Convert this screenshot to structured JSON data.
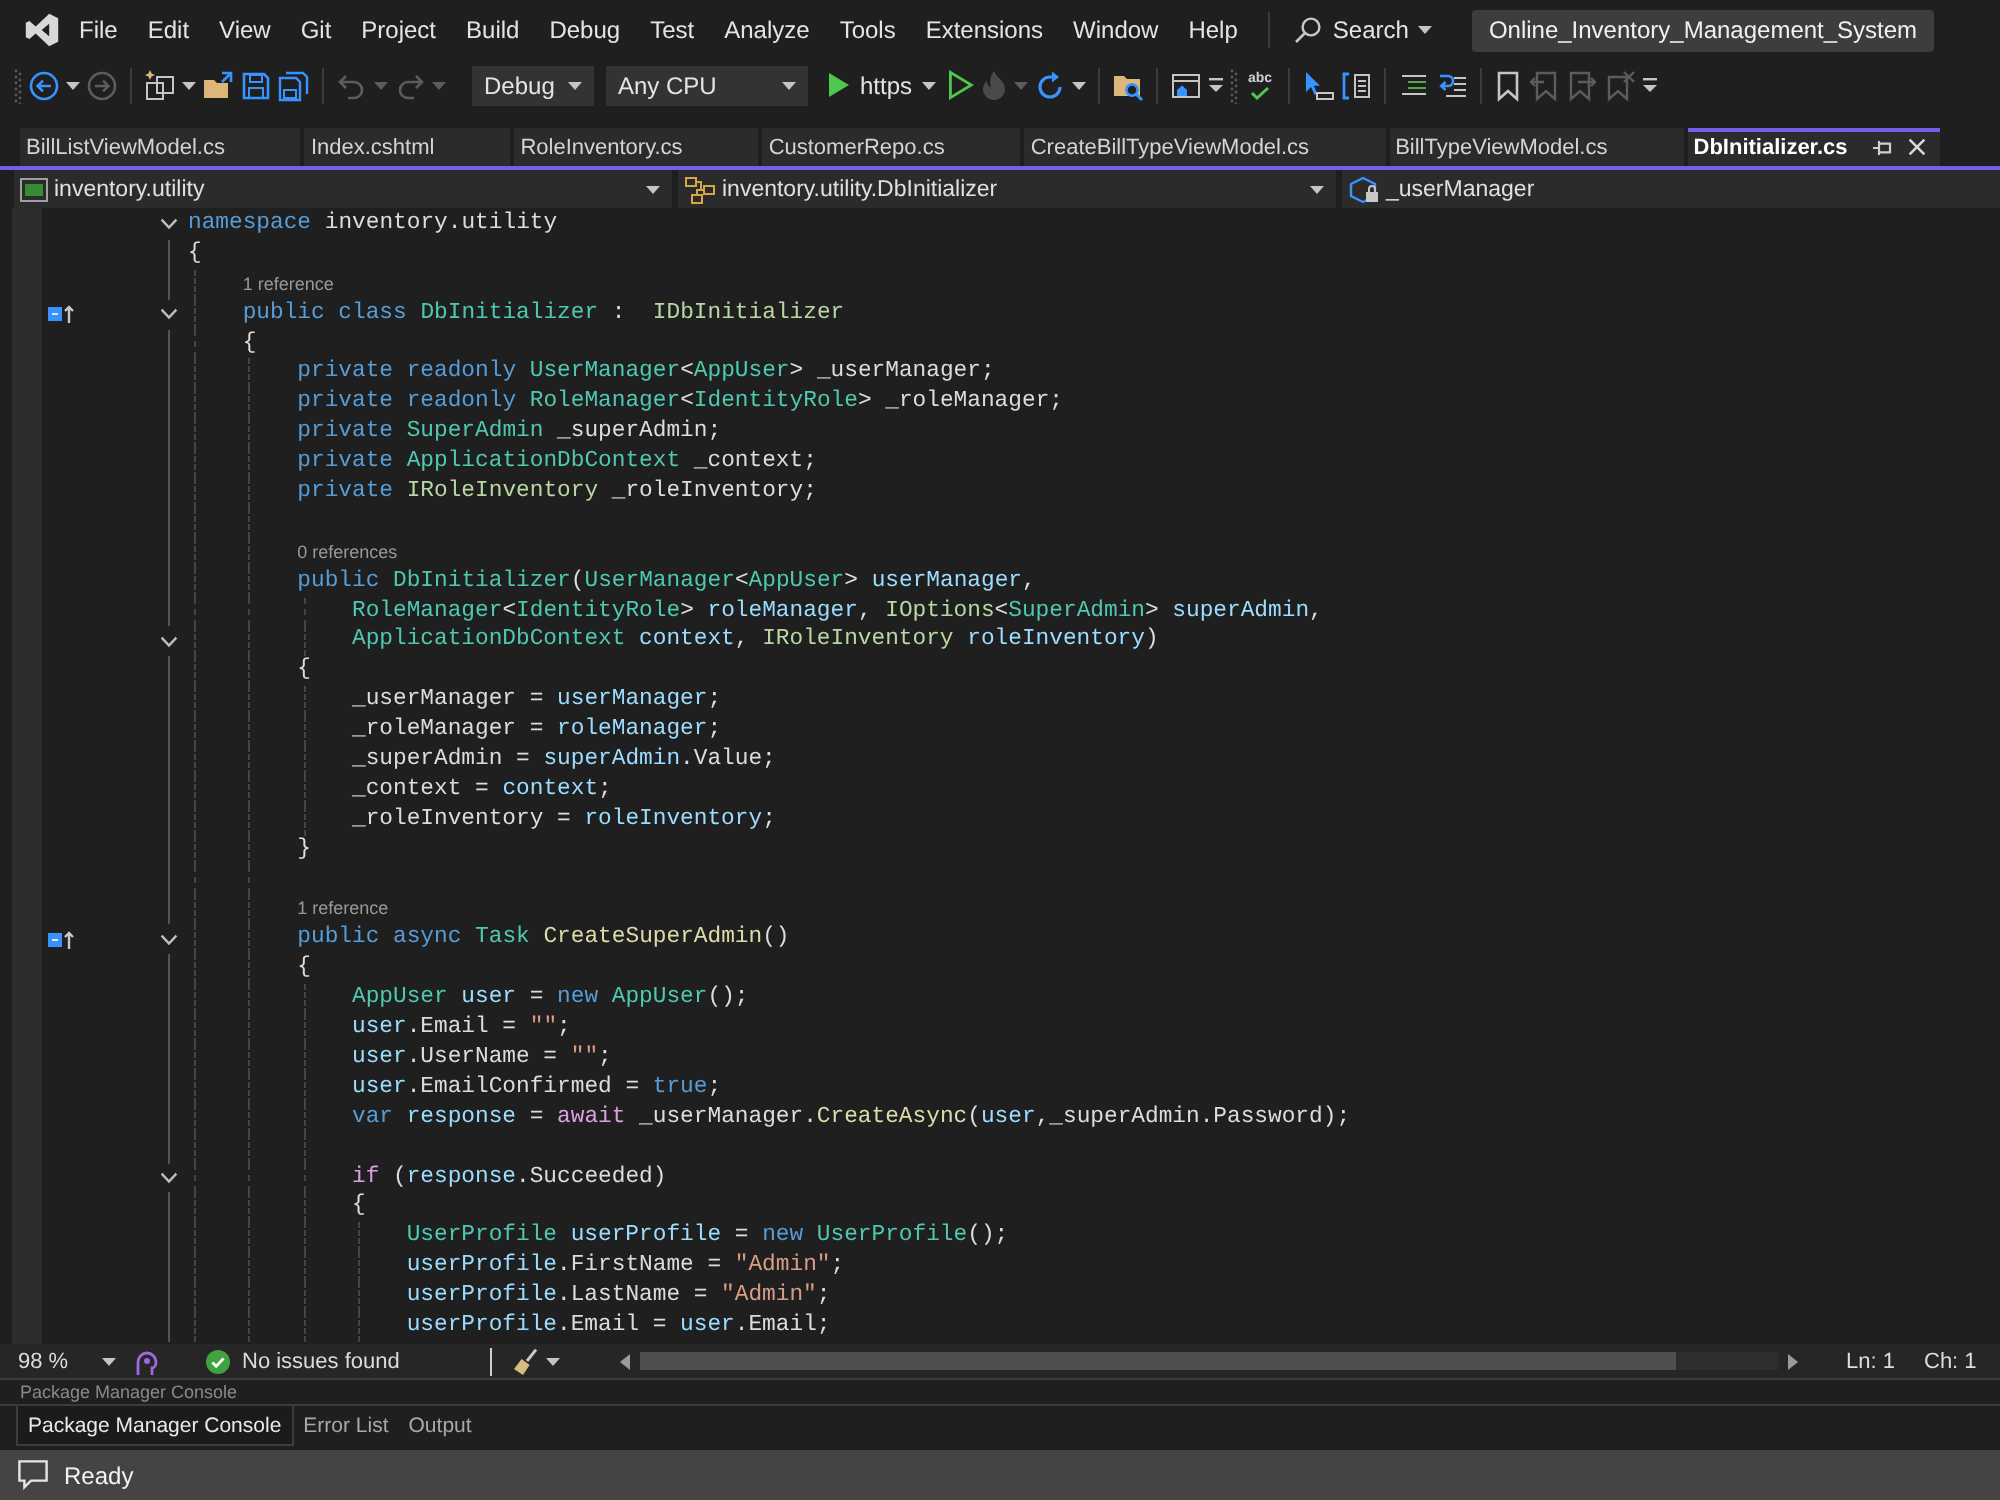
{
  "menu_bar": {
    "items": [
      "File",
      "Edit",
      "View",
      "Git",
      "Project",
      "Build",
      "Debug",
      "Test",
      "Analyze",
      "Tools",
      "Extensions",
      "Window",
      "Help"
    ],
    "search": "Search",
    "solution_name": "Online_Inventory_Management_System"
  },
  "toolbar": {
    "items": [
      {
        "kind": "grip"
      },
      {
        "kind": "back",
        "disabled": false
      },
      {
        "kind": "caret",
        "disabled": false
      },
      {
        "kind": "forward",
        "disabled": true
      },
      {
        "kind": "separator"
      },
      {
        "kind": "new-item",
        "disabled": false
      },
      {
        "kind": "caret",
        "disabled": false
      },
      {
        "kind": "open-folder",
        "disabled": false
      },
      {
        "kind": "save",
        "disabled": false
      },
      {
        "kind": "save-all",
        "disabled": false
      },
      {
        "kind": "separator"
      },
      {
        "kind": "undo",
        "disabled": true
      },
      {
        "kind": "caret",
        "disabled": true
      },
      {
        "kind": "redo",
        "disabled": true
      },
      {
        "kind": "caret",
        "disabled": true
      },
      {
        "kind": "configuration",
        "label": "Debug"
      },
      {
        "kind": "platform",
        "label": "Any CPU"
      },
      {
        "kind": "run",
        "label": "https"
      },
      {
        "kind": "run-outline",
        "disabled": false
      },
      {
        "kind": "flame",
        "disabled": true
      },
      {
        "kind": "caret",
        "disabled": true
      },
      {
        "kind": "restart",
        "disabled": false
      },
      {
        "kind": "caret",
        "disabled": false
      },
      {
        "kind": "separator"
      },
      {
        "kind": "folder-search",
        "disabled": false
      },
      {
        "kind": "separator"
      },
      {
        "kind": "window",
        "disabled": false
      },
      {
        "kind": "overflow"
      },
      {
        "kind": "grip"
      },
      {
        "kind": "spell-check",
        "label": "abc"
      },
      {
        "kind": "separator"
      },
      {
        "kind": "cursor",
        "disabled": false
      },
      {
        "kind": "bracket-doc",
        "disabled": false
      },
      {
        "kind": "separator"
      },
      {
        "kind": "comment",
        "disabled": false
      },
      {
        "kind": "uncomment",
        "disabled": false
      },
      {
        "kind": "separator"
      },
      {
        "kind": "bookmark",
        "disabled": false
      },
      {
        "kind": "bookmark-prev",
        "disabled": true
      },
      {
        "kind": "bookmark-next",
        "disabled": true
      },
      {
        "kind": "bookmark-clear",
        "disabled": true
      },
      {
        "kind": "overflow"
      }
    ]
  },
  "document_tabs": [
    {
      "label": "BillListViewModel.cs",
      "selected": false
    },
    {
      "label": "Index.cshtml",
      "selected": false
    },
    {
      "label": "RoleInventory.cs",
      "selected": false
    },
    {
      "label": "CustomerRepo.cs",
      "selected": false
    },
    {
      "label": "CreateBillTypeViewModel.cs",
      "selected": false
    },
    {
      "label": "BillTypeViewModel.cs",
      "selected": false
    },
    {
      "label": "DbInitializer.cs",
      "selected": true
    }
  ],
  "navigation_bar": [
    {
      "kind": "project",
      "label": "inventory.utility"
    },
    {
      "kind": "type",
      "label": "inventory.utility.DbInitializer"
    },
    {
      "kind": "member",
      "label": "_userManager"
    }
  ],
  "code_lines": [
    {
      "kind": "code",
      "expanded": true,
      "tokens": [
        {
          "text": "namespace",
          "kind": "keyword"
        },
        {
          "text": " inventory.utility",
          "kind": "plain"
        }
      ]
    },
    {
      "kind": "code",
      "tokens": [
        {
          "text": "{",
          "kind": "plain"
        }
      ],
      "children": [
        {
          "kind": "codelens",
          "text": "1 reference"
        },
        {
          "kind": "code",
          "expanded": true,
          "implements": true,
          "tokens": [
            {
              "text": "public class ",
              "kind": "keyword"
            },
            {
              "text": "DbInitializer",
              "kind": "type"
            },
            {
              "text": " :  ",
              "kind": "plain"
            },
            {
              "text": "IDbInitializer",
              "kind": "interface"
            }
          ]
        },
        {
          "kind": "code",
          "tokens": [
            {
              "text": "{",
              "kind": "plain"
            }
          ],
          "children": [
            {
              "kind": "code",
              "tokens": [
                {
                  "text": "private readonly ",
                  "kind": "keyword"
                },
                {
                  "text": "UserManager",
                  "kind": "type"
                },
                {
                  "text": "<",
                  "kind": "plain"
                },
                {
                  "text": "AppUser",
                  "kind": "type"
                },
                {
                  "text": "> _userManager;",
                  "kind": "plain"
                }
              ]
            },
            {
              "kind": "code",
              "tokens": [
                {
                  "text": "private readonly ",
                  "kind": "keyword"
                },
                {
                  "text": "RoleManager",
                  "kind": "type"
                },
                {
                  "text": "<",
                  "kind": "plain"
                },
                {
                  "text": "IdentityRole",
                  "kind": "type"
                },
                {
                  "text": "> _roleManager;",
                  "kind": "plain"
                }
              ]
            },
            {
              "kind": "code",
              "tokens": [
                {
                  "text": "private ",
                  "kind": "keyword"
                },
                {
                  "text": "SuperAdmin",
                  "kind": "type"
                },
                {
                  "text": " _superAdmin;",
                  "kind": "plain"
                }
              ]
            },
            {
              "kind": "code",
              "tokens": [
                {
                  "text": "private ",
                  "kind": "keyword"
                },
                {
                  "text": "ApplicationDbContext",
                  "kind": "type"
                },
                {
                  "text": " _context;",
                  "kind": "plain"
                }
              ]
            },
            {
              "kind": "code",
              "tokens": [
                {
                  "text": "private ",
                  "kind": "keyword"
                },
                {
                  "text": "IRoleInventory",
                  "kind": "interface"
                },
                {
                  "text": " _roleInventory;",
                  "kind": "plain"
                }
              ]
            },
            {
              "kind": "blank"
            },
            {
              "kind": "codelens",
              "text": "0 references"
            },
            {
              "kind": "code",
              "tokens": [
                {
                  "text": "public ",
                  "kind": "keyword"
                },
                {
                  "text": "DbInitializer",
                  "kind": "type"
                },
                {
                  "text": "(",
                  "kind": "plain"
                },
                {
                  "text": "UserManager",
                  "kind": "type"
                },
                {
                  "text": "<",
                  "kind": "plain"
                },
                {
                  "text": "AppUser",
                  "kind": "type"
                },
                {
                  "text": "> ",
                  "kind": "plain"
                },
                {
                  "text": "userManager",
                  "kind": "variable"
                },
                {
                  "text": ",",
                  "kind": "plain"
                }
              ],
              "children": [
                {
                  "kind": "code",
                  "tokens": [
                    {
                      "text": "RoleManager",
                      "kind": "type"
                    },
                    {
                      "text": "<",
                      "kind": "plain"
                    },
                    {
                      "text": "IdentityRole",
                      "kind": "type"
                    },
                    {
                      "text": "> ",
                      "kind": "plain"
                    },
                    {
                      "text": "roleManager",
                      "kind": "variable"
                    },
                    {
                      "text": ", ",
                      "kind": "plain"
                    },
                    {
                      "text": "IOptions",
                      "kind": "interface"
                    },
                    {
                      "text": "<",
                      "kind": "plain"
                    },
                    {
                      "text": "SuperAdmin",
                      "kind": "type"
                    },
                    {
                      "text": "> ",
                      "kind": "plain"
                    },
                    {
                      "text": "superAdmin",
                      "kind": "variable"
                    },
                    {
                      "text": ",",
                      "kind": "plain"
                    }
                  ]
                },
                {
                  "kind": "code",
                  "expanded": true,
                  "tokens": [
                    {
                      "text": "ApplicationDbContext ",
                      "kind": "type"
                    },
                    {
                      "text": "context",
                      "kind": "variable"
                    },
                    {
                      "text": ", ",
                      "kind": "plain"
                    },
                    {
                      "text": "IRoleInventory ",
                      "kind": "interface"
                    },
                    {
                      "text": "roleInventory",
                      "kind": "variable"
                    },
                    {
                      "text": ")",
                      "kind": "plain"
                    }
                  ]
                }
              ]
            },
            {
              "kind": "code",
              "tokens": [
                {
                  "text": "{",
                  "kind": "plain"
                }
              ],
              "children": [
                {
                  "kind": "code",
                  "tokens": [
                    {
                      "text": "_userManager = ",
                      "kind": "plain"
                    },
                    {
                      "text": "userManager",
                      "kind": "variable"
                    },
                    {
                      "text": ";",
                      "kind": "plain"
                    }
                  ]
                },
                {
                  "kind": "code",
                  "tokens": [
                    {
                      "text": "_roleManager = ",
                      "kind": "plain"
                    },
                    {
                      "text": "roleManager",
                      "kind": "variable"
                    },
                    {
                      "text": ";",
                      "kind": "plain"
                    }
                  ]
                },
                {
                  "kind": "code",
                  "tokens": [
                    {
                      "text": "_superAdmin = ",
                      "kind": "plain"
                    },
                    {
                      "text": "superAdmin",
                      "kind": "variable"
                    },
                    {
                      "text": ".Value;",
                      "kind": "plain"
                    }
                  ]
                },
                {
                  "kind": "code",
                  "tokens": [
                    {
                      "text": "_context = ",
                      "kind": "plain"
                    },
                    {
                      "text": "context",
                      "kind": "variable"
                    },
                    {
                      "text": ";",
                      "kind": "plain"
                    }
                  ]
                },
                {
                  "kind": "code",
                  "tokens": [
                    {
                      "text": "_roleInventory = ",
                      "kind": "plain"
                    },
                    {
                      "text": "roleInventory",
                      "kind": "variable"
                    },
                    {
                      "text": ";",
                      "kind": "plain"
                    }
                  ]
                }
              ]
            },
            {
              "kind": "code",
              "tokens": [
                {
                  "text": "}",
                  "kind": "plain"
                }
              ]
            },
            {
              "kind": "blank"
            },
            {
              "kind": "codelens",
              "text": "1 reference"
            },
            {
              "kind": "code",
              "expanded": true,
              "implements": true,
              "tokens": [
                {
                  "text": "public async ",
                  "kind": "keyword"
                },
                {
                  "text": "Task ",
                  "kind": "type"
                },
                {
                  "text": "CreateSuperAdmin",
                  "kind": "method"
                },
                {
                  "text": "()",
                  "kind": "plain"
                }
              ]
            },
            {
              "kind": "code",
              "tokens": [
                {
                  "text": "{",
                  "kind": "plain"
                }
              ],
              "children": [
                {
                  "kind": "code",
                  "tokens": [
                    {
                      "text": "AppUser ",
                      "kind": "type"
                    },
                    {
                      "text": "user",
                      "kind": "variable"
                    },
                    {
                      "text": " = ",
                      "kind": "plain"
                    },
                    {
                      "text": "new ",
                      "kind": "keyword"
                    },
                    {
                      "text": "AppUser",
                      "kind": "type"
                    },
                    {
                      "text": "();",
                      "kind": "plain"
                    }
                  ]
                },
                {
                  "kind": "code",
                  "tokens": [
                    {
                      "text": "user",
                      "kind": "variable"
                    },
                    {
                      "text": ".Email = ",
                      "kind": "plain"
                    },
                    {
                      "text": "\"\"",
                      "kind": "string"
                    },
                    {
                      "text": ";",
                      "kind": "plain"
                    }
                  ]
                },
                {
                  "kind": "code",
                  "tokens": [
                    {
                      "text": "user",
                      "kind": "variable"
                    },
                    {
                      "text": ".UserName = ",
                      "kind": "plain"
                    },
                    {
                      "text": "\"\"",
                      "kind": "string"
                    },
                    {
                      "text": ";",
                      "kind": "plain"
                    }
                  ]
                },
                {
                  "kind": "code",
                  "tokens": [
                    {
                      "text": "user",
                      "kind": "variable"
                    },
                    {
                      "text": ".EmailConfirmed = ",
                      "kind": "plain"
                    },
                    {
                      "text": "true",
                      "kind": "keyword"
                    },
                    {
                      "text": ";",
                      "kind": "plain"
                    }
                  ]
                },
                {
                  "kind": "code",
                  "tokens": [
                    {
                      "text": "var ",
                      "kind": "keyword"
                    },
                    {
                      "text": "response",
                      "kind": "variable"
                    },
                    {
                      "text": " = ",
                      "kind": "plain"
                    },
                    {
                      "text": "await",
                      "kind": "control"
                    },
                    {
                      "text": " _userManager.",
                      "kind": "plain"
                    },
                    {
                      "text": "CreateAsync",
                      "kind": "method"
                    },
                    {
                      "text": "(",
                      "kind": "plain"
                    },
                    {
                      "text": "user",
                      "kind": "variable"
                    },
                    {
                      "text": ",_superAdmin.Password);",
                      "kind": "plain"
                    }
                  ]
                },
                {
                  "kind": "blank"
                },
                {
                  "kind": "code",
                  "expanded": true,
                  "tokens": [
                    {
                      "text": "if",
                      "kind": "control"
                    },
                    {
                      "text": " (",
                      "kind": "plain"
                    },
                    {
                      "text": "response",
                      "kind": "variable"
                    },
                    {
                      "text": ".Succeeded)",
                      "kind": "plain"
                    }
                  ]
                },
                {
                  "kind": "code",
                  "tokens": [
                    {
                      "text": "{",
                      "kind": "plain"
                    }
                  ],
                  "children": [
                    {
                      "kind": "code",
                      "tokens": [
                        {
                          "text": "UserProfile ",
                          "kind": "type"
                        },
                        {
                          "text": "userProfile",
                          "kind": "variable"
                        },
                        {
                          "text": " = ",
                          "kind": "plain"
                        },
                        {
                          "text": "new ",
                          "kind": "keyword"
                        },
                        {
                          "text": "UserProfile",
                          "kind": "type"
                        },
                        {
                          "text": "();",
                          "kind": "plain"
                        }
                      ]
                    },
                    {
                      "kind": "code",
                      "tokens": [
                        {
                          "text": "userProfile",
                          "kind": "variable"
                        },
                        {
                          "text": ".FirstName = ",
                          "kind": "plain"
                        },
                        {
                          "text": "\"Admin\"",
                          "kind": "string"
                        },
                        {
                          "text": ";",
                          "kind": "plain"
                        }
                      ]
                    },
                    {
                      "kind": "code",
                      "tokens": [
                        {
                          "text": "userProfile",
                          "kind": "variable"
                        },
                        {
                          "text": ".LastName = ",
                          "kind": "plain"
                        },
                        {
                          "text": "\"Admin\"",
                          "kind": "string"
                        },
                        {
                          "text": ";",
                          "kind": "plain"
                        }
                      ]
                    },
                    {
                      "kind": "code",
                      "tokens": [
                        {
                          "text": "userProfile",
                          "kind": "variable"
                        },
                        {
                          "text": ".Email = ",
                          "kind": "plain"
                        },
                        {
                          "text": "user",
                          "kind": "variable"
                        },
                        {
                          "text": ".Email;",
                          "kind": "plain"
                        }
                      ]
                    }
                  ]
                }
              ]
            }
          ]
        }
      ]
    }
  ],
  "editor_status": {
    "zoom": "98 %",
    "issues": "No issues found",
    "line": "Ln: 1",
    "column": "Ch: 1"
  },
  "bottom_panel": {
    "title": "Package Manager Console",
    "tabs": [
      {
        "label": "Package Manager Console",
        "selected": true
      },
      {
        "label": "Error List",
        "selected": false
      },
      {
        "label": "Output",
        "selected": false
      }
    ]
  },
  "status_bar": {
    "text": "Ready"
  }
}
